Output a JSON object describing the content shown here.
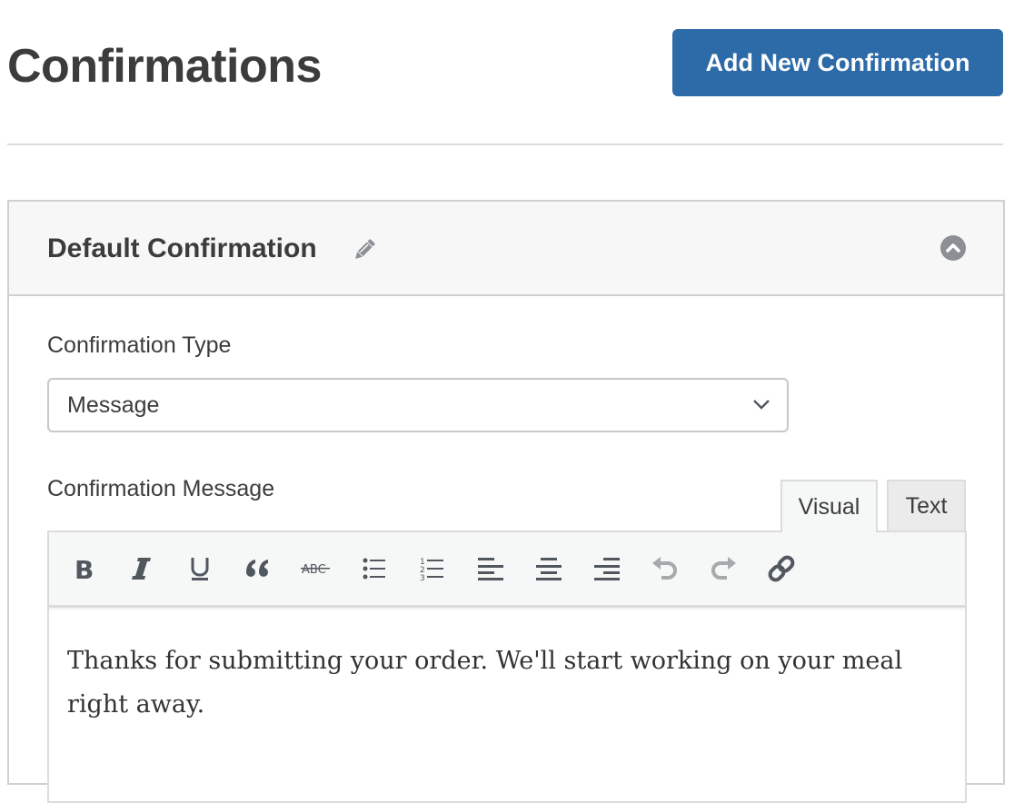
{
  "header": {
    "title": "Confirmations",
    "add_button_label": "Add New Confirmation"
  },
  "panel": {
    "title": "Default Confirmation",
    "edit_icon": "pencil-icon",
    "collapse_icon": "chevron-up-circle-icon",
    "confirmation_type": {
      "label": "Confirmation Type",
      "selected": "Message"
    },
    "confirmation_message": {
      "label": "Confirmation Message",
      "tabs": [
        {
          "label": "Visual",
          "active": true
        },
        {
          "label": "Text",
          "active": false
        }
      ],
      "toolbar": [
        {
          "name": "bold",
          "icon": "bold-icon"
        },
        {
          "name": "italic",
          "icon": "italic-icon"
        },
        {
          "name": "underline",
          "icon": "underline-icon"
        },
        {
          "name": "blockquote",
          "icon": "quote-icon"
        },
        {
          "name": "strikethrough",
          "icon": "strikethrough-icon"
        },
        {
          "name": "bulleted-list",
          "icon": "bullet-list-icon"
        },
        {
          "name": "numbered-list",
          "icon": "numbered-list-icon"
        },
        {
          "name": "align-left",
          "icon": "align-left-icon"
        },
        {
          "name": "align-center",
          "icon": "align-center-icon"
        },
        {
          "name": "align-right",
          "icon": "align-right-icon"
        },
        {
          "name": "undo",
          "icon": "undo-icon"
        },
        {
          "name": "redo",
          "icon": "redo-icon"
        },
        {
          "name": "insert-link",
          "icon": "link-icon"
        }
      ],
      "content": "Thanks for submitting your order. We'll start working on your meal right away."
    }
  },
  "colors": {
    "primary": "#2c6aa8",
    "icon": "#50575e",
    "icon_disabled": "#a7aaad"
  }
}
